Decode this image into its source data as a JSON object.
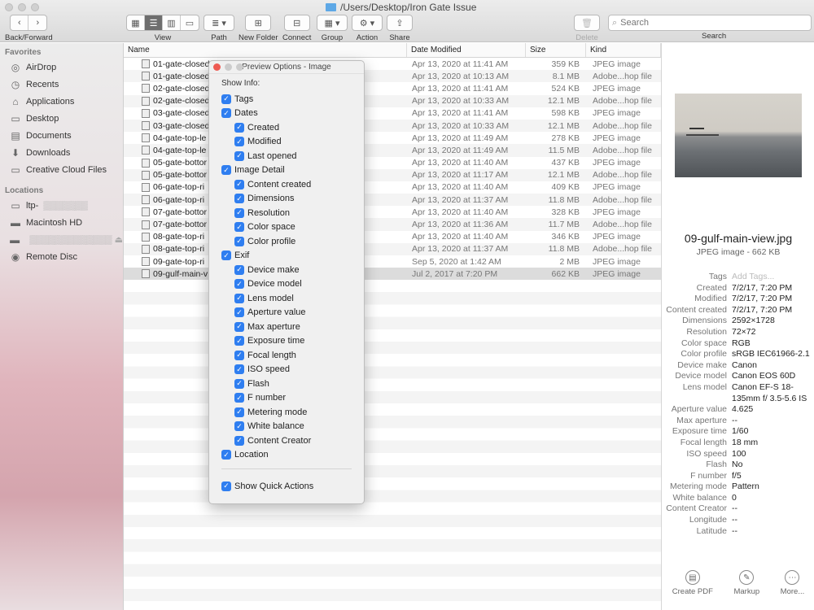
{
  "window": {
    "path": "/Users/Desktop/Iron Gate Issue"
  },
  "toolbar": {
    "back_forward": "Back/Forward",
    "view": "View",
    "path": "Path",
    "new_folder": "New Folder",
    "connect": "Connect",
    "group": "Group",
    "action": "Action",
    "share": "Share",
    "delete": "Delete",
    "search_placeholder": "Search",
    "search_label": "Search"
  },
  "sidebar": {
    "favorites_header": "Favorites",
    "favorites": [
      {
        "label": "AirDrop",
        "icon": "airdrop-icon"
      },
      {
        "label": "Recents",
        "icon": "clock-icon"
      },
      {
        "label": "Applications",
        "icon": "applications-icon"
      },
      {
        "label": "Desktop",
        "icon": "desktop-icon"
      },
      {
        "label": "Documents",
        "icon": "document-icon"
      },
      {
        "label": "Downloads",
        "icon": "download-icon"
      },
      {
        "label": "Creative Cloud Files",
        "icon": "folder-icon"
      }
    ],
    "locations_header": "Locations",
    "locations": [
      {
        "label": "ltp-",
        "icon": "computer-icon"
      },
      {
        "label": "Macintosh HD",
        "icon": "disk-icon"
      },
      {
        "label": "",
        "icon": "disk-icon"
      },
      {
        "label": "Remote Disc",
        "icon": "disc-icon"
      }
    ]
  },
  "list": {
    "headers": {
      "name": "Name",
      "date": "Date Modified",
      "size": "Size",
      "kind": "Kind"
    },
    "rows": [
      {
        "name": "01-gate-closed",
        "date": "Apr 13, 2020 at 11:41 AM",
        "size": "359 KB",
        "kind": "JPEG image"
      },
      {
        "name": "01-gate-closed",
        "date": "Apr 13, 2020 at 10:13 AM",
        "size": "8.1 MB",
        "kind": "Adobe...hop file"
      },
      {
        "name": "02-gate-closed",
        "date": "Apr 13, 2020 at 11:41 AM",
        "size": "524 KB",
        "kind": "JPEG image"
      },
      {
        "name": "02-gate-closed",
        "date": "Apr 13, 2020 at 10:33 AM",
        "size": "12.1 MB",
        "kind": "Adobe...hop file"
      },
      {
        "name": "03-gate-closed",
        "date": "Apr 13, 2020 at 11:41 AM",
        "size": "598 KB",
        "kind": "JPEG image"
      },
      {
        "name": "03-gate-closed",
        "date": "Apr 13, 2020 at 10:33 AM",
        "size": "12.1 MB",
        "kind": "Adobe...hop file"
      },
      {
        "name": "04-gate-top-le",
        "date": "Apr 13, 2020 at 11:49 AM",
        "size": "278 KB",
        "kind": "JPEG image"
      },
      {
        "name": "04-gate-top-le",
        "date": "Apr 13, 2020 at 11:49 AM",
        "size": "11.5 MB",
        "kind": "Adobe...hop file"
      },
      {
        "name": "05-gate-bottor",
        "date": "Apr 13, 2020 at 11:40 AM",
        "size": "437 KB",
        "kind": "JPEG image"
      },
      {
        "name": "05-gate-bottor",
        "date": "Apr 13, 2020 at 11:17 AM",
        "size": "12.1 MB",
        "kind": "Adobe...hop file"
      },
      {
        "name": "06-gate-top-ri",
        "date": "Apr 13, 2020 at 11:40 AM",
        "size": "409 KB",
        "kind": "JPEG image"
      },
      {
        "name": "06-gate-top-ri",
        "date": "Apr 13, 2020 at 11:37 AM",
        "size": "11.8 MB",
        "kind": "Adobe...hop file"
      },
      {
        "name": "07-gate-bottor",
        "date": "Apr 13, 2020 at 11:40 AM",
        "size": "328 KB",
        "kind": "JPEG image"
      },
      {
        "name": "07-gate-bottor",
        "date": "Apr 13, 2020 at 11:36 AM",
        "size": "11.7 MB",
        "kind": "Adobe...hop file"
      },
      {
        "name": "08-gate-top-ri",
        "date": "Apr 13, 2020 at 11:40 AM",
        "size": "346 KB",
        "kind": "JPEG image"
      },
      {
        "name": "08-gate-top-ri",
        "date": "Apr 13, 2020 at 11:37 AM",
        "size": "11.8 MB",
        "kind": "Adobe...hop file"
      },
      {
        "name": "09-gate-top-ri",
        "date": "Sep 5, 2020 at 1:42 AM",
        "size": "2 MB",
        "kind": "JPEG image"
      },
      {
        "name": "09-gulf-main-v",
        "date": "Jul 2, 2017 at 7:20 PM",
        "size": "662 KB",
        "kind": "JPEG image"
      }
    ]
  },
  "popup": {
    "title": "Preview Options - Image",
    "show_info": "Show Info:",
    "items": [
      {
        "label": "Tags",
        "level": 1
      },
      {
        "label": "Dates",
        "level": 1
      },
      {
        "label": "Created",
        "level": 2
      },
      {
        "label": "Modified",
        "level": 2
      },
      {
        "label": "Last opened",
        "level": 2
      },
      {
        "label": "Image Detail",
        "level": 1
      },
      {
        "label": "Content created",
        "level": 2
      },
      {
        "label": "Dimensions",
        "level": 2
      },
      {
        "label": "Resolution",
        "level": 2
      },
      {
        "label": "Color space",
        "level": 2
      },
      {
        "label": "Color profile",
        "level": 2
      },
      {
        "label": "Exif",
        "level": 1
      },
      {
        "label": "Device make",
        "level": 2
      },
      {
        "label": "Device model",
        "level": 2
      },
      {
        "label": "Lens model",
        "level": 2
      },
      {
        "label": "Aperture value",
        "level": 2
      },
      {
        "label": "Max aperture",
        "level": 2
      },
      {
        "label": "Exposure time",
        "level": 2
      },
      {
        "label": "Focal length",
        "level": 2
      },
      {
        "label": "ISO speed",
        "level": 2
      },
      {
        "label": "Flash",
        "level": 2
      },
      {
        "label": "F number",
        "level": 2
      },
      {
        "label": "Metering mode",
        "level": 2
      },
      {
        "label": "White balance",
        "level": 2
      },
      {
        "label": "Content Creator",
        "level": 2
      },
      {
        "label": "Location",
        "level": 1
      }
    ],
    "quick_actions": "Show Quick Actions"
  },
  "preview": {
    "filename": "09-gulf-main-view.jpg",
    "subtitle": "JPEG image - 662 KB",
    "meta": [
      {
        "k": "Tags",
        "v": "Add Tags...",
        "placeholder": true
      },
      {
        "k": "Created",
        "v": "7/2/17, 7:20 PM"
      },
      {
        "k": "Modified",
        "v": "7/2/17, 7:20 PM"
      },
      {
        "k": "Content created",
        "v": "7/2/17, 7:20 PM"
      },
      {
        "k": "Dimensions",
        "v": "2592×1728"
      },
      {
        "k": "Resolution",
        "v": "72×72"
      },
      {
        "k": "Color space",
        "v": "RGB"
      },
      {
        "k": "Color profile",
        "v": "sRGB IEC61966-2.1"
      },
      {
        "k": "Device make",
        "v": "Canon"
      },
      {
        "k": "Device model",
        "v": "Canon EOS 60D"
      },
      {
        "k": "Lens model",
        "v": "Canon EF-S 18-135mm f/ 3.5-5.6 IS"
      },
      {
        "k": "Aperture value",
        "v": "4.625"
      },
      {
        "k": "Max aperture",
        "v": "--"
      },
      {
        "k": "Exposure time",
        "v": "1/60"
      },
      {
        "k": "Focal length",
        "v": "18 mm"
      },
      {
        "k": "ISO speed",
        "v": "100"
      },
      {
        "k": "Flash",
        "v": "No"
      },
      {
        "k": "F number",
        "v": "f/5"
      },
      {
        "k": "Metering mode",
        "v": "Pattern"
      },
      {
        "k": "White balance",
        "v": "0"
      },
      {
        "k": "Content Creator",
        "v": "--"
      },
      {
        "k": "Longitude",
        "v": "--"
      },
      {
        "k": "Latitude",
        "v": "--"
      }
    ],
    "actions": [
      {
        "label": "Create PDF",
        "icon": "pdf-icon"
      },
      {
        "label": "Markup",
        "icon": "markup-icon"
      },
      {
        "label": "More...",
        "icon": "more-icon"
      }
    ]
  }
}
